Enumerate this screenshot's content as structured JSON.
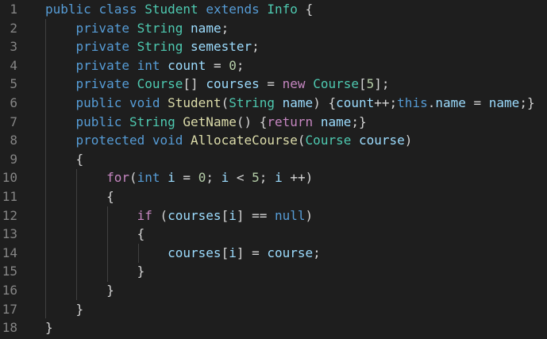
{
  "editor": {
    "theme_colors": {
      "background": "#1e1e1e",
      "line_number": "#858585",
      "keyword": "#569cd6",
      "type": "#4ec9b0",
      "variable": "#9cdcfe",
      "number": "#b5cea8",
      "function": "#dcdcaa",
      "control": "#c586c0",
      "punctuation": "#d4d4d4",
      "indent_guide": "#404040"
    },
    "lines": [
      {
        "n": "1",
        "tokens": [
          [
            "public",
            "kw"
          ],
          [
            " ",
            "punc"
          ],
          [
            "class",
            "kw"
          ],
          [
            " ",
            "punc"
          ],
          [
            "Student",
            "type"
          ],
          [
            " ",
            "punc"
          ],
          [
            "extends",
            "kw"
          ],
          [
            " ",
            "punc"
          ],
          [
            "Info",
            "type"
          ],
          [
            " {",
            "punc"
          ]
        ]
      },
      {
        "n": "2",
        "tokens": [
          [
            "    ",
            "punc"
          ],
          [
            "private",
            "kw"
          ],
          [
            " ",
            "punc"
          ],
          [
            "String",
            "type"
          ],
          [
            " ",
            "punc"
          ],
          [
            "name",
            "var"
          ],
          [
            ";",
            "punc"
          ]
        ]
      },
      {
        "n": "3",
        "tokens": [
          [
            "    ",
            "punc"
          ],
          [
            "private",
            "kw"
          ],
          [
            " ",
            "punc"
          ],
          [
            "String",
            "type"
          ],
          [
            " ",
            "punc"
          ],
          [
            "semester",
            "var"
          ],
          [
            ";",
            "punc"
          ]
        ]
      },
      {
        "n": "4",
        "tokens": [
          [
            "    ",
            "punc"
          ],
          [
            "private",
            "kw"
          ],
          [
            " ",
            "punc"
          ],
          [
            "int",
            "kw"
          ],
          [
            " ",
            "punc"
          ],
          [
            "count",
            "var"
          ],
          [
            " = ",
            "punc"
          ],
          [
            "0",
            "num"
          ],
          [
            ";",
            "punc"
          ]
        ]
      },
      {
        "n": "5",
        "tokens": [
          [
            "    ",
            "punc"
          ],
          [
            "private",
            "kw"
          ],
          [
            " ",
            "punc"
          ],
          [
            "Course",
            "type"
          ],
          [
            "[] ",
            "punc"
          ],
          [
            "courses",
            "var"
          ],
          [
            " = ",
            "punc"
          ],
          [
            "new",
            "ctl"
          ],
          [
            " ",
            "punc"
          ],
          [
            "Course",
            "type"
          ],
          [
            "[",
            "punc"
          ],
          [
            "5",
            "num"
          ],
          [
            "];",
            "punc"
          ]
        ]
      },
      {
        "n": "6",
        "tokens": [
          [
            "    ",
            "punc"
          ],
          [
            "public",
            "kw"
          ],
          [
            " ",
            "punc"
          ],
          [
            "void",
            "kw"
          ],
          [
            " ",
            "punc"
          ],
          [
            "Student",
            "fn"
          ],
          [
            "(",
            "punc"
          ],
          [
            "String",
            "type"
          ],
          [
            " ",
            "punc"
          ],
          [
            "name",
            "var"
          ],
          [
            ") {",
            "punc"
          ],
          [
            "count",
            "var"
          ],
          [
            "++;",
            "punc"
          ],
          [
            "this",
            "kw"
          ],
          [
            ".",
            "punc"
          ],
          [
            "name",
            "var"
          ],
          [
            " = ",
            "punc"
          ],
          [
            "name",
            "var"
          ],
          [
            ";}",
            "punc"
          ]
        ]
      },
      {
        "n": "7",
        "tokens": [
          [
            "    ",
            "punc"
          ],
          [
            "public",
            "kw"
          ],
          [
            " ",
            "punc"
          ],
          [
            "String",
            "type"
          ],
          [
            " ",
            "punc"
          ],
          [
            "GetName",
            "fn"
          ],
          [
            "() {",
            "punc"
          ],
          [
            "return",
            "ctl"
          ],
          [
            " ",
            "punc"
          ],
          [
            "name",
            "var"
          ],
          [
            ";}",
            "punc"
          ]
        ]
      },
      {
        "n": "8",
        "tokens": [
          [
            "    ",
            "punc"
          ],
          [
            "protected",
            "kw"
          ],
          [
            " ",
            "punc"
          ],
          [
            "void",
            "kw"
          ],
          [
            " ",
            "punc"
          ],
          [
            "AllocateCourse",
            "fn"
          ],
          [
            "(",
            "punc"
          ],
          [
            "Course",
            "type"
          ],
          [
            " ",
            "punc"
          ],
          [
            "course",
            "var"
          ],
          [
            ")",
            "punc"
          ]
        ]
      },
      {
        "n": "9",
        "tokens": [
          [
            "    {",
            "punc"
          ]
        ]
      },
      {
        "n": "10",
        "tokens": [
          [
            "        ",
            "punc"
          ],
          [
            "for",
            "ctl"
          ],
          [
            "(",
            "punc"
          ],
          [
            "int",
            "kw"
          ],
          [
            " ",
            "punc"
          ],
          [
            "i",
            "var"
          ],
          [
            " = ",
            "punc"
          ],
          [
            "0",
            "num"
          ],
          [
            "; ",
            "punc"
          ],
          [
            "i",
            "var"
          ],
          [
            " < ",
            "punc"
          ],
          [
            "5",
            "num"
          ],
          [
            "; ",
            "punc"
          ],
          [
            "i",
            "var"
          ],
          [
            " ++)",
            "punc"
          ]
        ]
      },
      {
        "n": "11",
        "tokens": [
          [
            "        {",
            "punc"
          ]
        ]
      },
      {
        "n": "12",
        "tokens": [
          [
            "            ",
            "punc"
          ],
          [
            "if",
            "ctl"
          ],
          [
            " (",
            "punc"
          ],
          [
            "courses",
            "var"
          ],
          [
            "[",
            "punc"
          ],
          [
            "i",
            "var"
          ],
          [
            "] == ",
            "punc"
          ],
          [
            "null",
            "kw"
          ],
          [
            ")",
            "punc"
          ]
        ]
      },
      {
        "n": "13",
        "tokens": [
          [
            "            {",
            "punc"
          ]
        ]
      },
      {
        "n": "14",
        "tokens": [
          [
            "                ",
            "punc"
          ],
          [
            "courses",
            "var"
          ],
          [
            "[",
            "punc"
          ],
          [
            "i",
            "var"
          ],
          [
            "] = ",
            "punc"
          ],
          [
            "course",
            "var"
          ],
          [
            ";",
            "punc"
          ]
        ]
      },
      {
        "n": "15",
        "tokens": [
          [
            "            }",
            "punc"
          ]
        ]
      },
      {
        "n": "16",
        "tokens": [
          [
            "        }",
            "punc"
          ]
        ]
      },
      {
        "n": "17",
        "tokens": [
          [
            "    }",
            "punc"
          ]
        ]
      },
      {
        "n": "18",
        "tokens": [
          [
            "}",
            "punc"
          ]
        ]
      }
    ]
  }
}
